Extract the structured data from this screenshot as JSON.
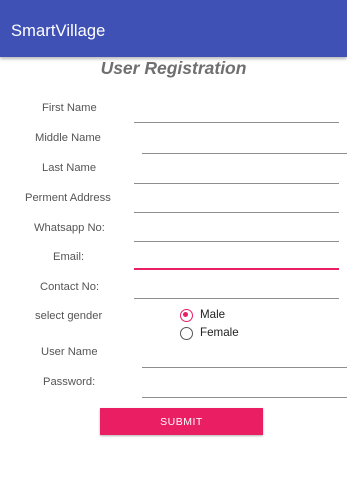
{
  "app": {
    "title": "SmartVillage"
  },
  "form": {
    "title": "User Registration",
    "fields": {
      "first_name": {
        "label": "First Name",
        "value": ""
      },
      "middle_name": {
        "label": "Middle Name",
        "value": ""
      },
      "last_name": {
        "label": "Last Name",
        "value": ""
      },
      "permanent_address": {
        "label": "Perment Address",
        "value": ""
      },
      "whatsapp_no": {
        "label": "Whatsapp No:",
        "value": ""
      },
      "email": {
        "label": "Email:",
        "value": ""
      },
      "contact_no": {
        "label": "Contact No:",
        "value": ""
      },
      "user_name": {
        "label": "User Name",
        "value": ""
      },
      "password": {
        "label": "Password:",
        "value": ""
      }
    },
    "gender": {
      "label": "select gender",
      "options": [
        {
          "label": "Male",
          "selected": true
        },
        {
          "label": "Female",
          "selected": false
        }
      ]
    },
    "submit_label": "SUBMIT"
  },
  "colors": {
    "app_bar": "#3f51b5",
    "accent": "#e91e63",
    "title_text": "#6f6f6f"
  }
}
